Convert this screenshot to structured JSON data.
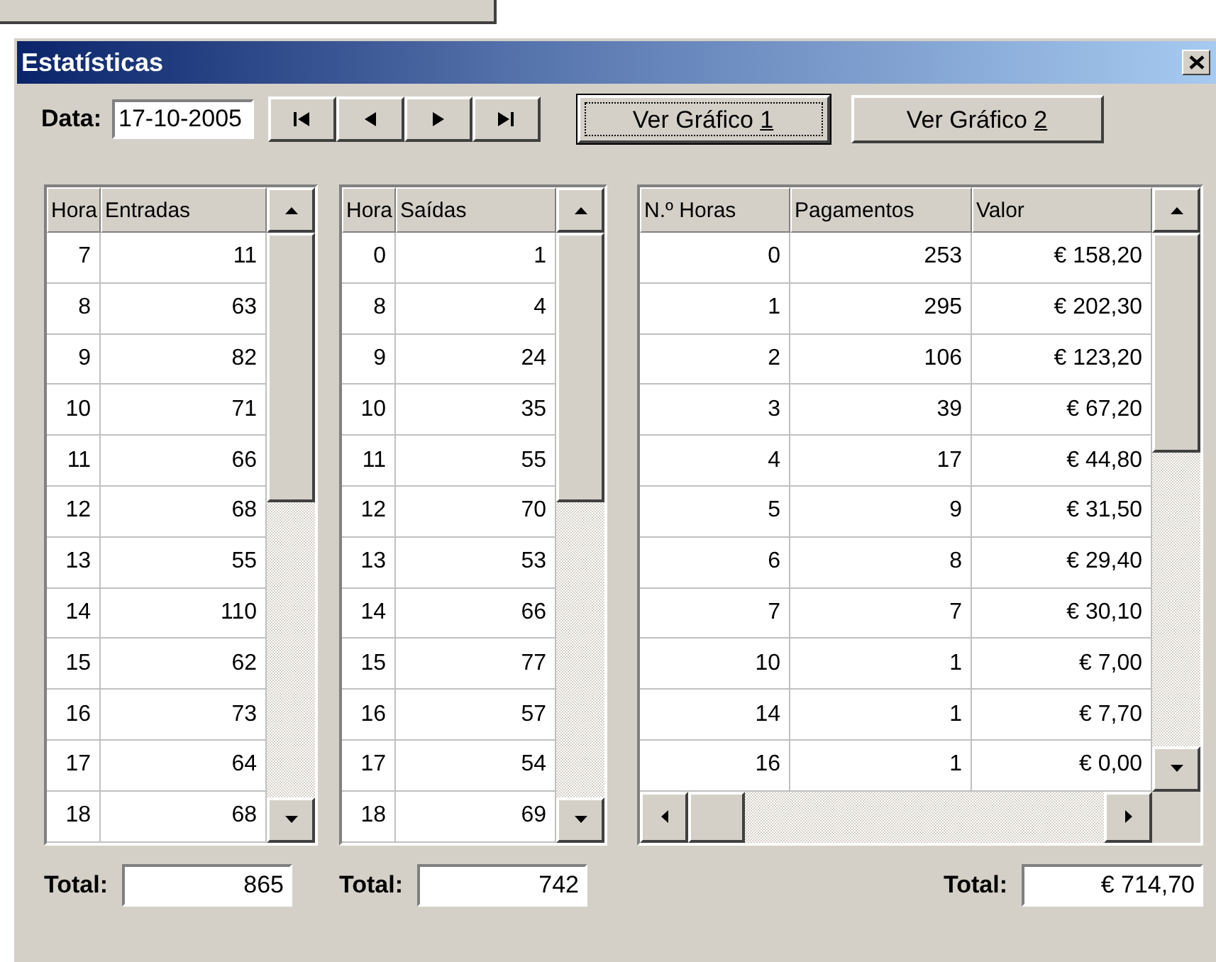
{
  "window": {
    "title": "Estatísticas"
  },
  "toolbar": {
    "date_label": "Data:",
    "date_value": "17-10-2005",
    "buttons": [
      {
        "label": "Ver Gráfico ",
        "mnemonic": "1",
        "focused": true
      },
      {
        "label": "Ver Gráfico ",
        "mnemonic": "2",
        "focused": false
      }
    ]
  },
  "tables": [
    {
      "kind": "vertical",
      "columns": [
        "Hora",
        "Entradas"
      ],
      "total_label": "Total:",
      "total": "865",
      "rows": [
        [
          "7",
          "11"
        ],
        [
          "8",
          "63"
        ],
        [
          "9",
          "82"
        ],
        [
          "10",
          "71"
        ],
        [
          "11",
          "66"
        ],
        [
          "12",
          "68"
        ],
        [
          "13",
          "55"
        ],
        [
          "14",
          "110"
        ],
        [
          "15",
          "62"
        ],
        [
          "16",
          "73"
        ],
        [
          "17",
          "64"
        ],
        [
          "18",
          "68"
        ]
      ]
    },
    {
      "kind": "vertical",
      "columns": [
        "Hora",
        "Saídas"
      ],
      "total_label": "Total:",
      "total": "742",
      "rows": [
        [
          "0",
          "1"
        ],
        [
          "8",
          "4"
        ],
        [
          "9",
          "24"
        ],
        [
          "10",
          "35"
        ],
        [
          "11",
          "55"
        ],
        [
          "12",
          "70"
        ],
        [
          "13",
          "53"
        ],
        [
          "14",
          "66"
        ],
        [
          "15",
          "77"
        ],
        [
          "16",
          "57"
        ],
        [
          "17",
          "54"
        ],
        [
          "18",
          "69"
        ]
      ]
    },
    {
      "kind": "both",
      "columns": [
        "N.º Horas",
        "Pagamentos",
        "Valor"
      ],
      "total_label": "Total:",
      "total": "€ 714,70",
      "rows": [
        [
          "0",
          "253",
          "€ 158,20"
        ],
        [
          "1",
          "295",
          "€ 202,30"
        ],
        [
          "2",
          "106",
          "€ 123,20"
        ],
        [
          "3",
          "39",
          "€ 67,20"
        ],
        [
          "4",
          "17",
          "€ 44,80"
        ],
        [
          "5",
          "9",
          "€ 31,50"
        ],
        [
          "6",
          "8",
          "€ 29,40"
        ],
        [
          "7",
          "7",
          "€ 30,10"
        ],
        [
          "10",
          "1",
          "€ 7,00"
        ],
        [
          "14",
          "1",
          "€ 7,70"
        ],
        [
          "16",
          "1",
          "€ 0,00"
        ]
      ]
    }
  ]
}
